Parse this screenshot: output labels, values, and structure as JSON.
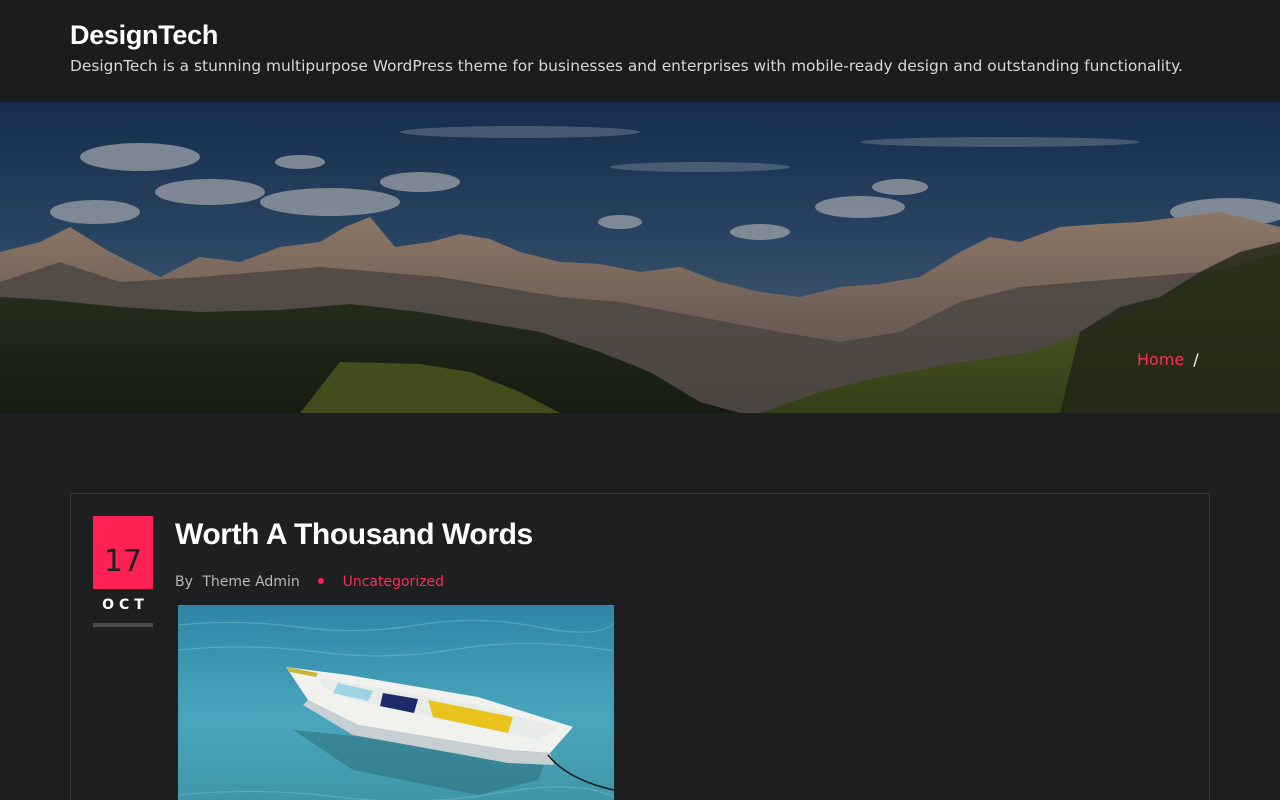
{
  "header": {
    "site_title": "DesignTech",
    "site_description": "DesignTech is a stunning multipurpose WordPress theme for businesses and enterprises with mobile-ready design and outstanding functionality."
  },
  "banner": {
    "breadcrumb_home": "Home",
    "breadcrumb_separator": "/"
  },
  "post": {
    "date_day": "17",
    "date_month": "OCT",
    "title": "Worth A Thousand Words",
    "by_label": "By",
    "author": "Theme Admin",
    "category": "Uncategorized"
  },
  "colors": {
    "accent": "#ff2153",
    "background": "#1e1f21",
    "header_background": "#1b1c1e"
  }
}
